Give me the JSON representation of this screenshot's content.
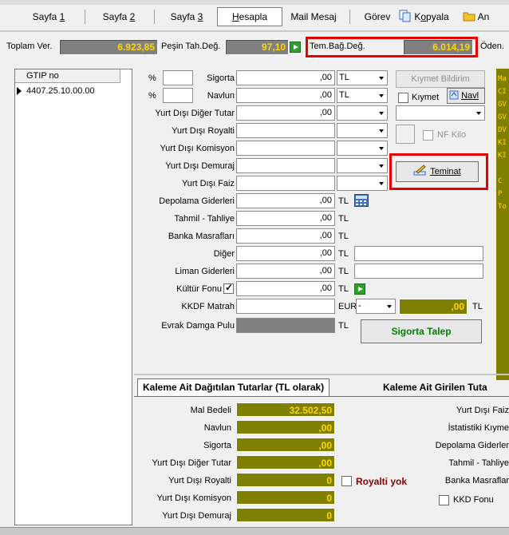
{
  "tabs": [
    {
      "label_pre": "Sayfa ",
      "label_ul": "1"
    },
    {
      "label_pre": "Sayfa ",
      "label_ul": "2"
    },
    {
      "label_pre": "Sayfa ",
      "label_ul": "3"
    },
    {
      "label_pre": "",
      "label_ul": "H",
      "label_post": "esapla"
    },
    {
      "label_pre": "Mail Mesaj",
      "label_ul": ""
    },
    {
      "label_pre": "Görev",
      "label_ul": ""
    },
    {
      "label_pre": "K",
      "label_ul": "o",
      "label_post": "pyala"
    },
    {
      "label_pre": "An",
      "label_ul": ""
    }
  ],
  "totals": {
    "toplam_label": "Toplam Ver.",
    "toplam_value": "6.923,85",
    "pesin_label": "Peşin Tah.Değ.",
    "pesin_value": "97,10",
    "tem_label": "Tem.Bağ.Değ.",
    "tem_value": "6.014,19",
    "oden_label": "Öden."
  },
  "gtip": {
    "header": "GTIP no",
    "rows": [
      "4407.25.10.00.00"
    ]
  },
  "form": {
    "pct1": "%",
    "sigorta_label": "Sigorta",
    "sigorta_value": ",00",
    "sigorta_cur": "TL",
    "pct2": "%",
    "navlun_label": "Navlun",
    "navlun_value": ",00",
    "navlun_cur": "TL",
    "ydd_label": "Yurt Dışı Diğer Tutar",
    "ydd_value": ",00",
    "ydr_label": "Yurt Dışı Royalti",
    "ydk_label": "Yurt Dışı Komisyon",
    "yddem_label": "Yurt Dışı Demuraj",
    "ydf_label": "Yurt Dışı Faiz",
    "depolama_label": "Depolama Giderleri",
    "depolama_value": ",00",
    "depolama_cur": "TL",
    "tahmil_label": "Tahmil - Tahliye",
    "tahmil_value": ",00",
    "tahmil_cur": "TL",
    "banka_label": "Banka Masrafları",
    "banka_value": ",00",
    "banka_cur": "TL",
    "diger_label": "Diğer",
    "diger_value": ",00",
    "diger_cur": "TL",
    "liman_label": "Liman Giderleri",
    "liman_value": ",00",
    "liman_cur": "TL",
    "kultur_label": "Kültür Fonu",
    "kultur_value": ",00",
    "kultur_cur": "TL",
    "kkdf_label": "KKDF Matrah",
    "kkdf_cur": "EUR",
    "kkdf_combo": "-",
    "kkdf_result": ",00",
    "kkdf_result_cur": "TL",
    "evrak_label": "Evrak Damga Pulu",
    "evrak_cur": "TL",
    "kiymet_bildirim": "Kıymet Bildirim",
    "kiymet_label": "Kıymet",
    "navl_button": "Navl",
    "nf_kilo": "NF Kilo",
    "teminat_button": "Teminat",
    "sigorta_talep_button": "Sigorta Talep"
  },
  "right_panel": [
    "Ma",
    "CI",
    "GV",
    "GV",
    "DV",
    "KI",
    "KI",
    "C",
    "P",
    "To"
  ],
  "bottom": {
    "tab1": "Kaleme Ait Dağıtılan Tutarlar (TL olarak)",
    "tab2": "Kaleme Ait Girilen Tuta",
    "mal_bedeli_label": "Mal Bedeli",
    "mal_bedeli_value": "32.502,50",
    "navlun_label": "Navlun",
    "navlun_value": ",00",
    "sigorta_label": "Sigorta",
    "sigorta_value": ",00",
    "ydd_label": "Yurt Dışı Diğer Tutar",
    "ydd_value": ",00",
    "ydr_label": "Yurt Dışı Royalti",
    "ydr_value": "0",
    "ydk_label": "Yurt Dışı Komisyon",
    "ydk_value": "0",
    "yddem_label": "Yurt Dışı Demuraj",
    "yddem_value": "0",
    "royalti_yok": "Royalti yok",
    "r_ydf": "Yurt Dışı Faiz",
    "r_ist": "İstatistiki Kıyme",
    "r_dep": "Depolama Giderler",
    "r_tah": "Tahmil - Tahliye",
    "r_ban": "Banka Masraflar",
    "r_kkd": "KKD Fonu"
  },
  "colors": {
    "accent_red": "#e60000",
    "olive": "#808000",
    "gold": "#ffd700",
    "green": "#008000"
  }
}
